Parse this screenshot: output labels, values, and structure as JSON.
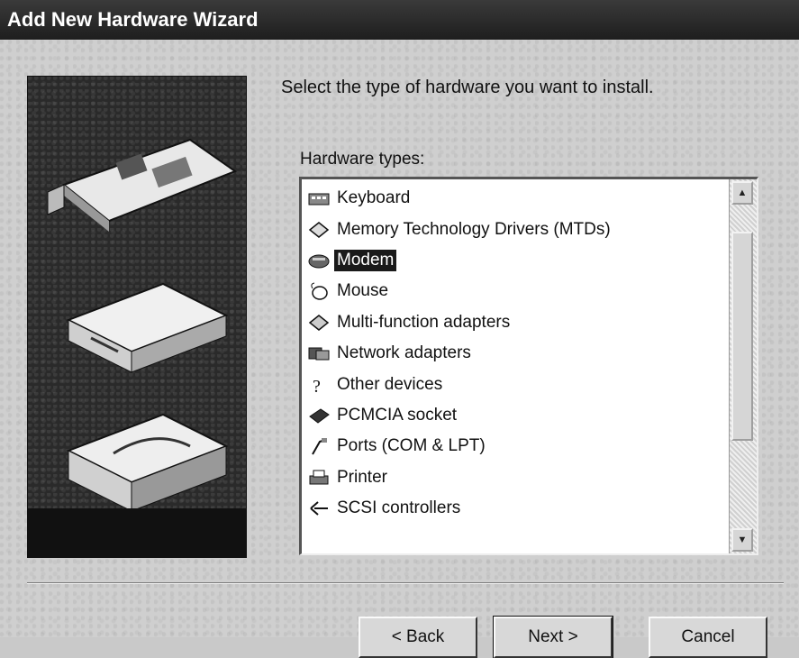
{
  "window": {
    "title": "Add New Hardware Wizard"
  },
  "prompt": "Select the type of hardware you want to install.",
  "list": {
    "label": "Hardware types:",
    "selected_index": 2,
    "items": [
      {
        "label": "Keyboard",
        "icon": "keyboard-icon"
      },
      {
        "label": "Memory Technology Drivers (MTDs)",
        "icon": "memory-icon"
      },
      {
        "label": "Modem",
        "icon": "modem-icon"
      },
      {
        "label": "Mouse",
        "icon": "mouse-icon"
      },
      {
        "label": "Multi-function adapters",
        "icon": "multifunction-icon"
      },
      {
        "label": "Network adapters",
        "icon": "network-icon"
      },
      {
        "label": "Other devices",
        "icon": "question-icon"
      },
      {
        "label": "PCMCIA socket",
        "icon": "pcmcia-icon"
      },
      {
        "label": "Ports (COM & LPT)",
        "icon": "port-icon"
      },
      {
        "label": "Printer",
        "icon": "printer-icon"
      },
      {
        "label": "SCSI controllers",
        "icon": "scsi-icon"
      }
    ]
  },
  "buttons": {
    "back": "< Back",
    "next": "Next >",
    "cancel": "Cancel"
  },
  "colors": {
    "titlebar": "#1e1e1e",
    "selection": "#1a1a1a",
    "face": "#d8d8d8"
  }
}
